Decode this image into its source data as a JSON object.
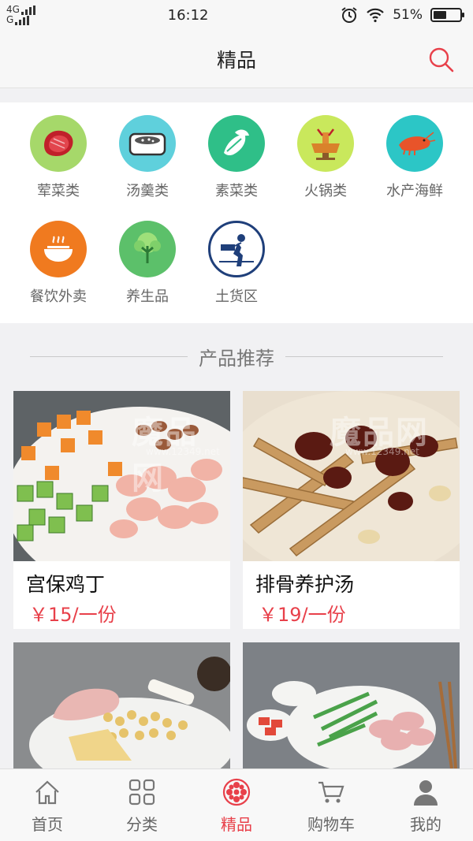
{
  "status": {
    "network_top": "4G",
    "network_bottom": "G",
    "time": "16:12",
    "battery": "51%",
    "battery_level": 0.51
  },
  "header": {
    "title": "精品"
  },
  "categories": [
    {
      "label": "荤菜类",
      "icon": "meat-icon",
      "color": "#a6d86a"
    },
    {
      "label": "汤羹类",
      "icon": "soup-pot-icon",
      "color": "#5fd0dc"
    },
    {
      "label": "素菜类",
      "icon": "vegetable-icon",
      "color": "#2fbf88"
    },
    {
      "label": "火锅类",
      "icon": "hotpot-icon",
      "color": "#c9e85c"
    },
    {
      "label": "水产海鲜",
      "icon": "shrimp-icon",
      "color": "#2cc6c6"
    },
    {
      "label": "餐饮外卖",
      "icon": "takeout-bowl-icon",
      "color": "#f07a1f"
    },
    {
      "label": "养生品",
      "icon": "wellness-tree-icon",
      "color": "#5cc06a"
    },
    {
      "label": "土货区",
      "icon": "farmer-icon",
      "color": "#ffffff"
    }
  ],
  "section": {
    "title": "产品推荐"
  },
  "products": [
    {
      "name": "宫保鸡丁",
      "price": "￥15/一份"
    },
    {
      "name": "排骨养护汤",
      "price": "￥19/一份"
    },
    {
      "name": "",
      "price": ""
    },
    {
      "name": "",
      "price": ""
    }
  ],
  "watermark": {
    "main": "魔品网",
    "sub": "www.12349.net"
  },
  "tabs": [
    {
      "label": "首页",
      "icon": "home-icon",
      "active": false
    },
    {
      "label": "分类",
      "icon": "grid-icon",
      "active": false
    },
    {
      "label": "精品",
      "icon": "flower-icon",
      "active": true
    },
    {
      "label": "购物车",
      "icon": "cart-icon",
      "active": false
    },
    {
      "label": "我的",
      "icon": "user-icon",
      "active": false
    }
  ],
  "colors": {
    "accent": "#e8404a",
    "muted_text": "#666666"
  }
}
